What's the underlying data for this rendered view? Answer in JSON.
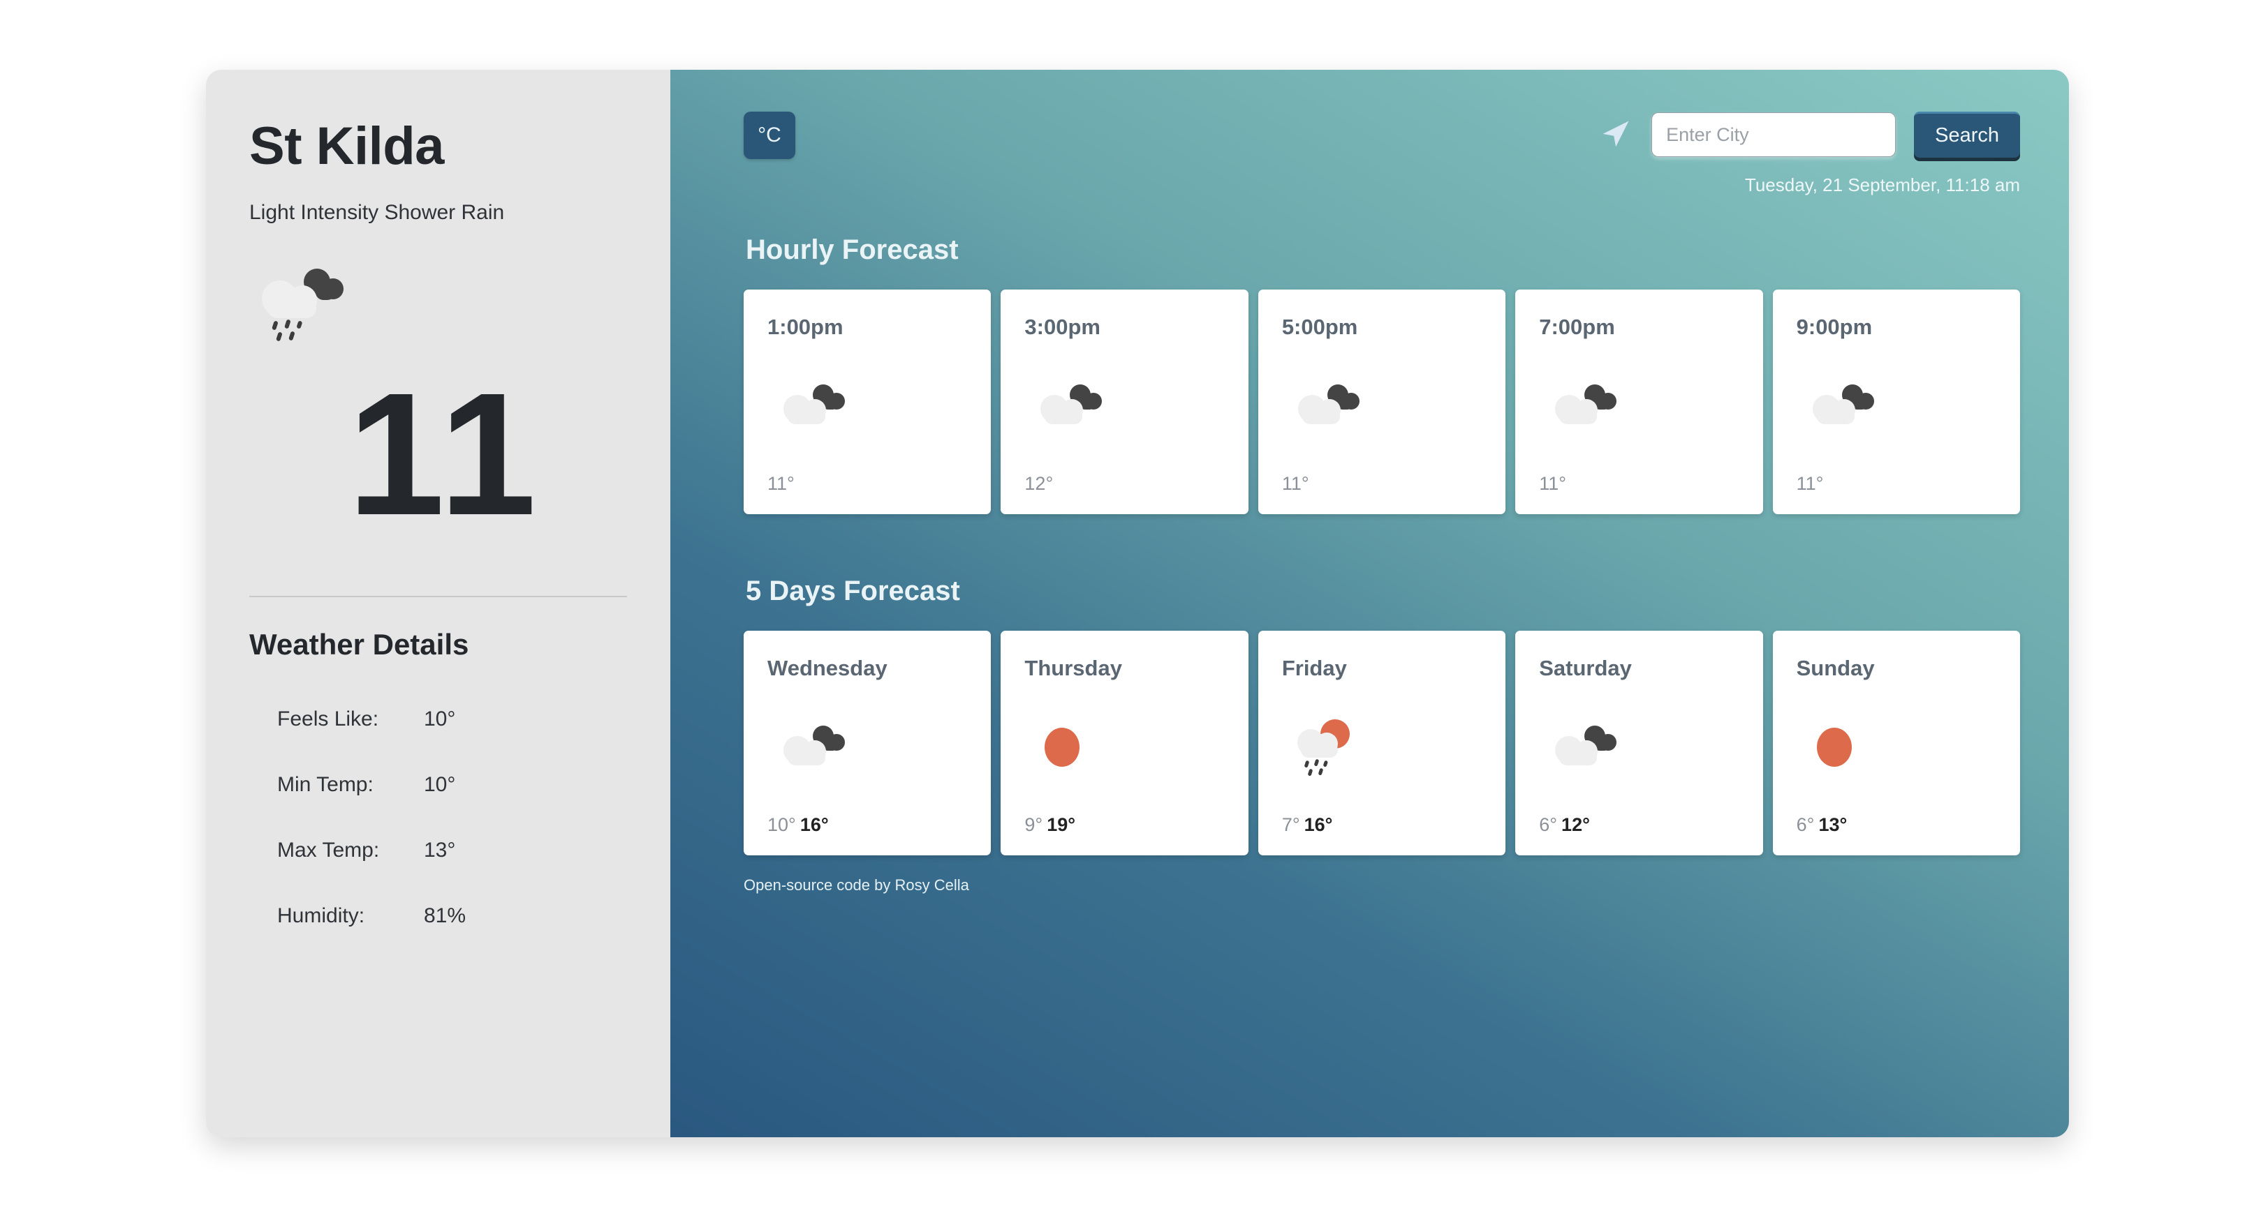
{
  "sidebar": {
    "city": "St Kilda",
    "description": "Light Intensity Shower Rain",
    "current_icon": "shower-rain-icon",
    "temperature": "11",
    "details_title": "Weather Details",
    "details": [
      {
        "label": "Feels Like:",
        "value": "10°"
      },
      {
        "label": "Min Temp:",
        "value": "10°"
      },
      {
        "label": "Max Temp:",
        "value": "13°"
      },
      {
        "label": "Humidity:",
        "value": "81%"
      }
    ]
  },
  "topbar": {
    "unit_toggle": "°C",
    "geo_icon": "location-arrow-icon",
    "search_placeholder": "Enter City",
    "search_value": "",
    "search_button": "Search",
    "datetime": "Tuesday, 21 September, 11:18 am"
  },
  "hourly": {
    "title": "Hourly Forecast",
    "items": [
      {
        "time": "1:00pm",
        "icon": "broken-clouds-icon",
        "temp": "11°"
      },
      {
        "time": "3:00pm",
        "icon": "broken-clouds-icon",
        "temp": "12°"
      },
      {
        "time": "5:00pm",
        "icon": "broken-clouds-icon",
        "temp": "11°"
      },
      {
        "time": "7:00pm",
        "icon": "broken-clouds-icon",
        "temp": "11°"
      },
      {
        "time": "9:00pm",
        "icon": "broken-clouds-icon",
        "temp": "11°"
      }
    ]
  },
  "daily": {
    "title": "5 Days Forecast",
    "items": [
      {
        "day": "Wednesday",
        "icon": "broken-clouds-icon",
        "min": "10°",
        "max": "16°"
      },
      {
        "day": "Thursday",
        "icon": "clear-sun-icon",
        "min": "9°",
        "max": "19°"
      },
      {
        "day": "Friday",
        "icon": "sun-shower-rain-icon",
        "min": "7°",
        "max": "16°"
      },
      {
        "day": "Saturday",
        "icon": "broken-clouds-icon",
        "min": "6°",
        "max": "12°"
      },
      {
        "day": "Sunday",
        "icon": "clear-sun-icon",
        "min": "6°",
        "max": "13°"
      }
    ]
  },
  "footer": {
    "note": "Open-source code by Rosy Cella"
  },
  "colors": {
    "sidebar_bg": "#e6e6e6",
    "gradient_start": "#2a5880",
    "gradient_end": "#8bc9c4",
    "accent_dark": "#2a5677",
    "sun_orange": "#dd6b4b",
    "cloud_light": "#efefef",
    "cloud_dark": "#444444"
  }
}
